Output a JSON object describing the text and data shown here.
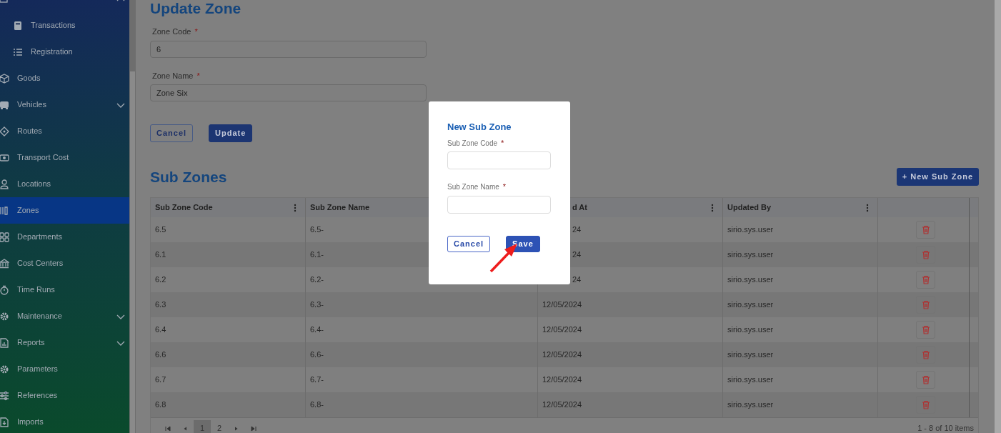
{
  "sidebar": {
    "items": [
      {
        "selected": false,
        "expanded": true,
        "children": [
          {
            "label": "Transactions",
            "selected": false
          },
          {
            "label": "Registration",
            "selected": false
          }
        ]
      },
      {
        "label": "Goods",
        "selected": false
      },
      {
        "label": "Vehicles",
        "selected": false,
        "expanded": false
      },
      {
        "label": "Routes",
        "selected": false
      },
      {
        "label": "Transport Cost",
        "selected": false
      },
      {
        "label": "Locations",
        "selected": false
      },
      {
        "label": "Zones",
        "selected": true
      },
      {
        "label": "Departments",
        "selected": false
      },
      {
        "label": "Cost Centers",
        "selected": false
      },
      {
        "label": "Time Runs",
        "selected": false
      },
      {
        "label": "Maintenance",
        "selected": false,
        "expanded": false
      },
      {
        "label": "Reports",
        "selected": false,
        "expanded": false
      },
      {
        "label": "Parameters",
        "selected": false
      },
      {
        "label": "References",
        "selected": false
      },
      {
        "label": "Imports",
        "selected": false
      }
    ]
  },
  "form": {
    "title": "Update Zone",
    "fields": [
      {
        "label": "Zone Code",
        "required_mark": "*",
        "value": "6"
      },
      {
        "label": "Zone Name",
        "required_mark": "*",
        "value": "Zone Six"
      }
    ],
    "buttons": [
      {
        "label": "Cancel",
        "kind": "outline"
      },
      {
        "label": "Update",
        "kind": "primary"
      }
    ]
  },
  "sub_zones": {
    "title": "Sub Zones",
    "new_button": "+ New Sub Zone",
    "table": {
      "columns": [
        {
          "label": "Sub Zone Code",
          "menu": true
        },
        {
          "label": "Sub Zone Name",
          "menu": false
        },
        {
          "label": "d At",
          "menu": true
        },
        {
          "label": "Updated By",
          "menu": true
        }
      ],
      "rows": [
        {
          "code": "6.5",
          "name": "6.5-",
          "updated_at": "24",
          "updated_by": "sirio.sys.user"
        },
        {
          "code": "6.1",
          "name": "6.1-",
          "updated_at": "24",
          "updated_by": "sirio.sys.user"
        },
        {
          "code": "6.2",
          "name": "6.2-",
          "updated_at": "24",
          "updated_by": "sirio.sys.user"
        },
        {
          "code": "6.3",
          "name": "6.3-",
          "updated_at": "12/05/2024",
          "updated_by": "sirio.sys.user"
        },
        {
          "code": "6.4",
          "name": "6.4-",
          "updated_at": "12/05/2024",
          "updated_by": "sirio.sys.user"
        },
        {
          "code": "6.6",
          "name": "6.6-",
          "updated_at": "12/05/2024",
          "updated_by": "sirio.sys.user"
        },
        {
          "code": "6.7",
          "name": "6.7-",
          "updated_at": "12/05/2024",
          "updated_by": "sirio.sys.user"
        },
        {
          "code": "6.8",
          "name": "6.8-",
          "updated_at": "12/05/2024",
          "updated_by": "sirio.sys.user"
        }
      ]
    },
    "pager": {
      "pages": [
        {
          "label": "1",
          "selected": true
        },
        {
          "label": "2",
          "selected": false
        }
      ],
      "summary": "1 - 8 of 10 items"
    }
  },
  "modal": {
    "title": "New Sub Zone",
    "fields": [
      {
        "label": "Sub Zone Code",
        "required_mark": "*"
      },
      {
        "label": "Sub Zone Name",
        "required_mark": "*"
      }
    ],
    "buttons": [
      {
        "label": "Cancel",
        "kind": "outline"
      },
      {
        "label": "Save",
        "kind": "primary"
      }
    ]
  }
}
